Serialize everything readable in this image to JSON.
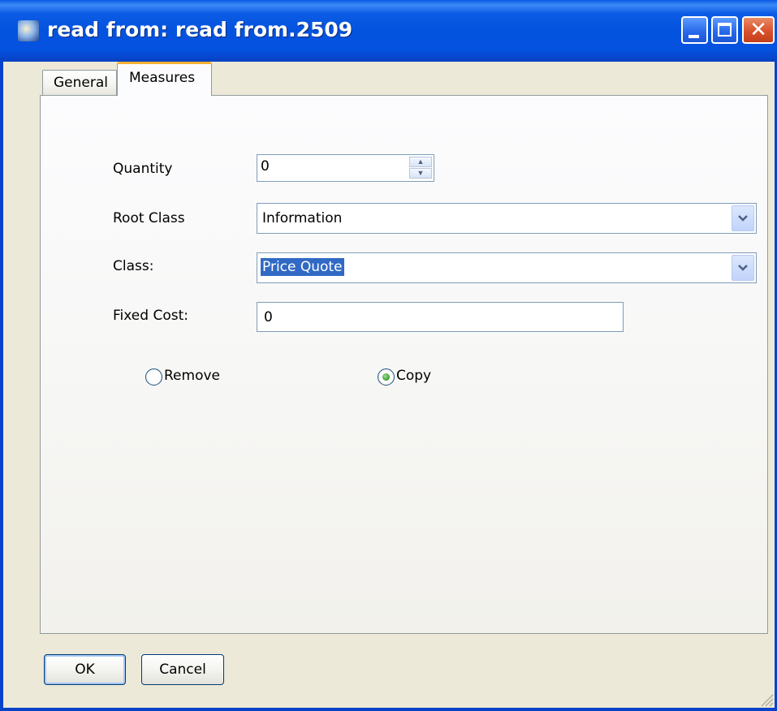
{
  "window": {
    "title": "read from: read from.2509",
    "icon": "app-icon",
    "controls": {
      "minimize": "minimize-icon",
      "maximize": "maximize-icon",
      "close": "close-icon",
      "close_glyph": "✕"
    }
  },
  "tabs": [
    {
      "label": "General",
      "active": false
    },
    {
      "label": "Measures",
      "active": true
    }
  ],
  "form": {
    "quantity": {
      "label": "Quantity",
      "value": "0"
    },
    "root_class": {
      "label": "Root Class",
      "value": "Information"
    },
    "class": {
      "label": "Class:",
      "value": "Price Quote"
    },
    "fixed_cost": {
      "label": "Fixed Cost:",
      "value": "0"
    },
    "mode": {
      "options": [
        {
          "label": "Remove",
          "checked": false
        },
        {
          "label": "Copy",
          "checked": true
        }
      ]
    }
  },
  "buttons": {
    "ok": "OK",
    "cancel": "Cancel"
  },
  "colors": {
    "titlebar": "#0453de",
    "selection": "#316ac5",
    "active_tab_accent": "#f7b031",
    "dialog_background": "#ece9d8"
  }
}
